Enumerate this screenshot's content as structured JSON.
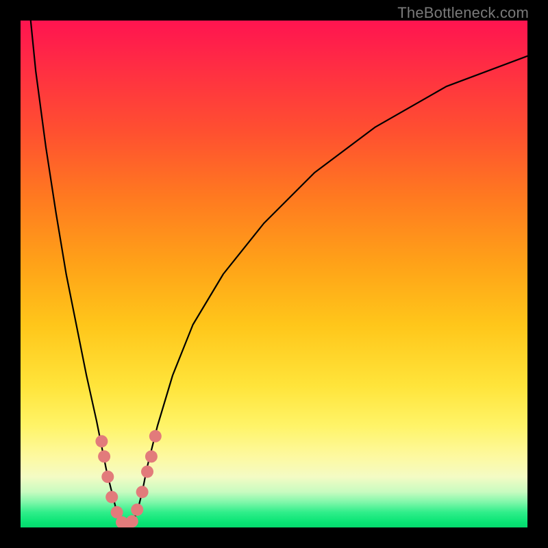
{
  "watermark": "TheBottleneck.com",
  "chart_data": {
    "type": "line",
    "title": "",
    "xlabel": "",
    "ylabel": "",
    "xlim": [
      0,
      100
    ],
    "ylim": [
      0,
      100
    ],
    "series": [
      {
        "name": "bottleneck-curve",
        "x": [
          2,
          3,
          5,
          7,
          9,
          11,
          13,
          15,
          16,
          17,
          18,
          19,
          20,
          21,
          22,
          23,
          24,
          25,
          27,
          30,
          34,
          40,
          48,
          58,
          70,
          84,
          100
        ],
        "y": [
          100,
          90,
          75,
          62,
          50,
          40,
          30,
          21,
          16,
          11,
          7,
          3,
          1,
          0.5,
          1,
          3,
          7,
          12,
          20,
          30,
          40,
          50,
          60,
          70,
          79,
          87,
          93
        ]
      }
    ],
    "markers": {
      "name": "highlight-points",
      "color": "#e27b7b",
      "points": [
        {
          "x": 16.0,
          "y": 17
        },
        {
          "x": 16.5,
          "y": 14
        },
        {
          "x": 17.2,
          "y": 10
        },
        {
          "x": 18.0,
          "y": 6
        },
        {
          "x": 19.0,
          "y": 3
        },
        {
          "x": 20.0,
          "y": 1.0
        },
        {
          "x": 21.0,
          "y": 0.6
        },
        {
          "x": 22.0,
          "y": 1.2
        },
        {
          "x": 23.0,
          "y": 3.5
        },
        {
          "x": 24.0,
          "y": 7
        },
        {
          "x": 25.0,
          "y": 11
        },
        {
          "x": 25.8,
          "y": 14
        },
        {
          "x": 26.6,
          "y": 18
        }
      ]
    }
  }
}
